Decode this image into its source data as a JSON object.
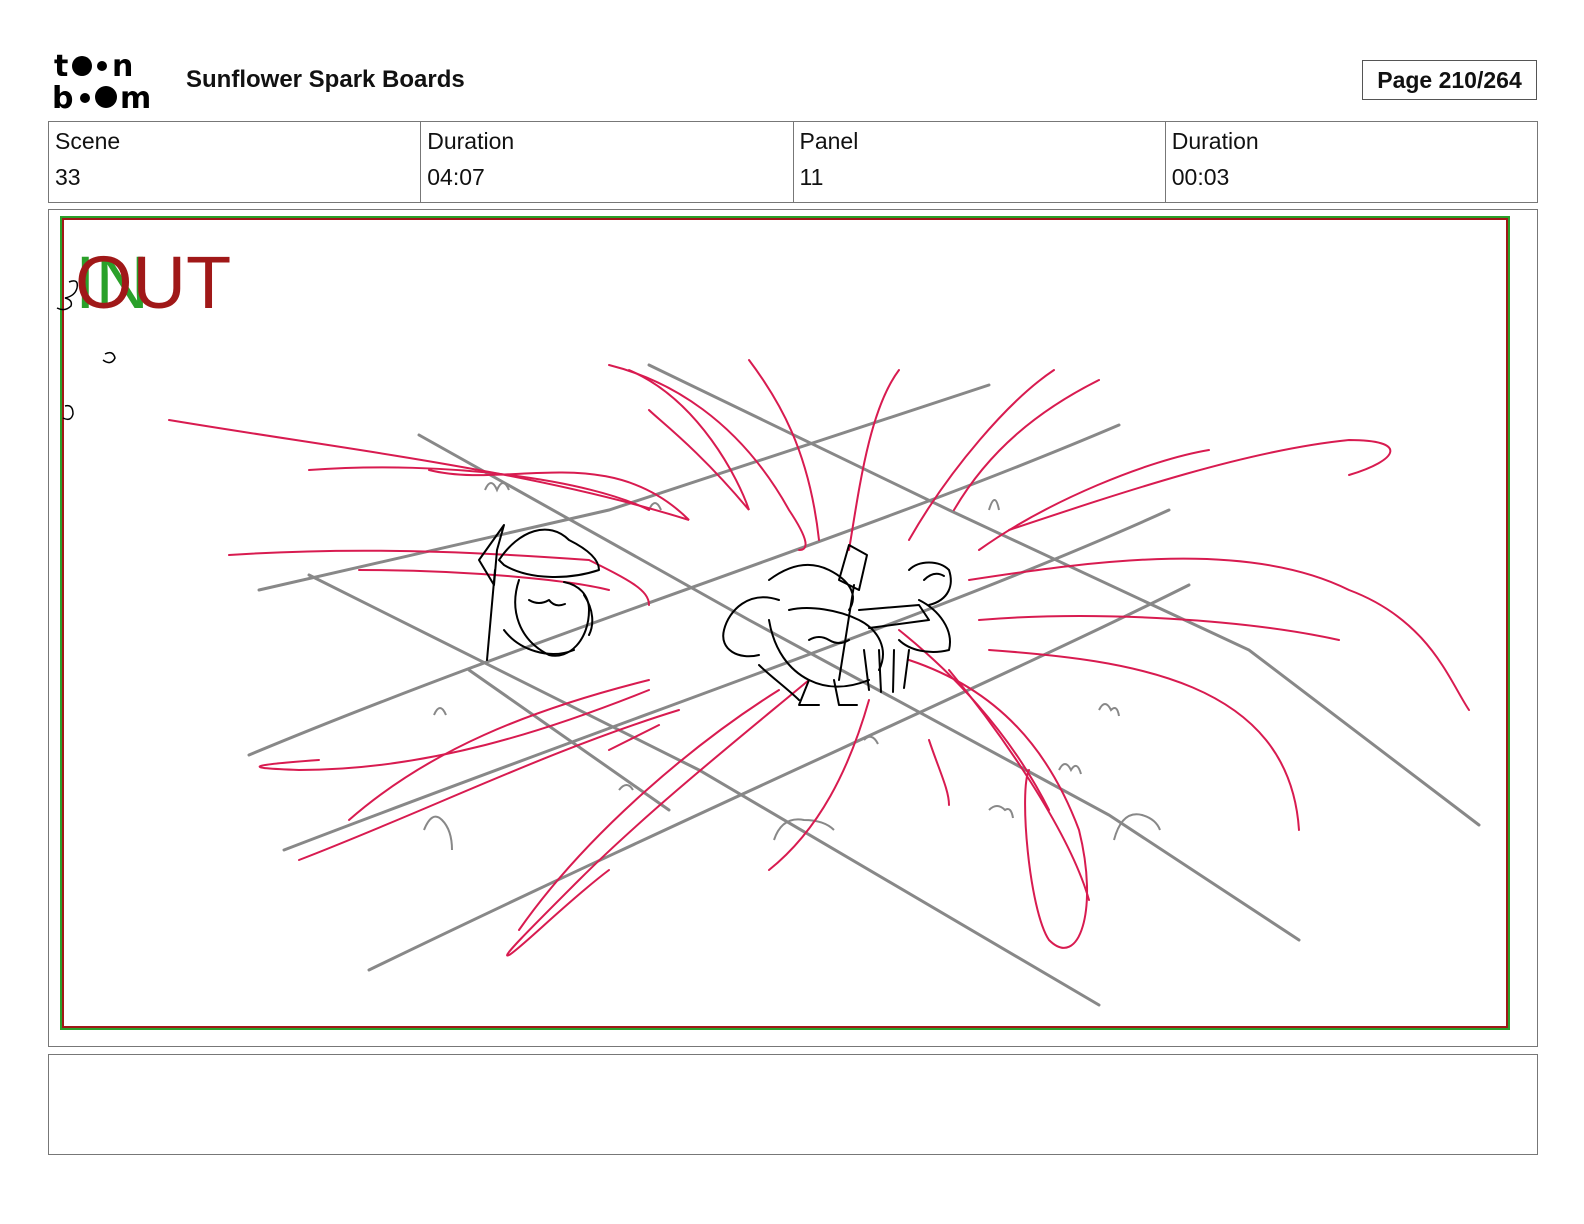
{
  "header": {
    "logo_line1": "to●n",
    "logo_line2": "b●●m",
    "title": "Sunflower Spark Boards",
    "page_label": "Page 210/264"
  },
  "info": {
    "scene_label": "Scene",
    "scene_value": "33",
    "scene_duration_label": "Duration",
    "scene_duration_value": "04:07",
    "panel_label": "Panel",
    "panel_value": "11",
    "panel_duration_label": "Duration",
    "panel_duration_value": "00:03"
  },
  "panel": {
    "in_mark": "IN",
    "out_mark": "OUT",
    "colors": {
      "frame_red": "#a01818",
      "frame_green": "#2aa02a",
      "energy_lines": "#d81b50",
      "ground_lines": "#888888",
      "character_ink": "#000000"
    }
  },
  "notes": {
    "text": ""
  }
}
